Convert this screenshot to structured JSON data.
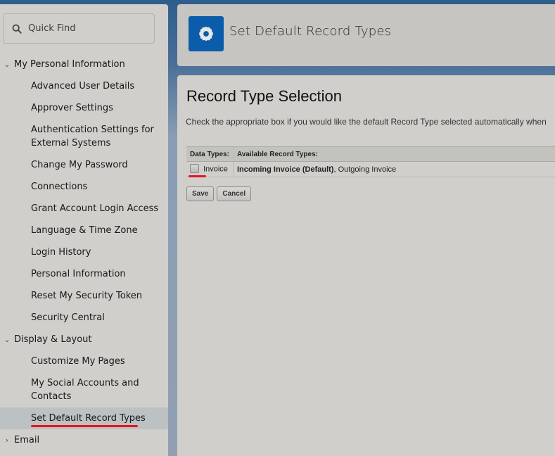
{
  "sidebar": {
    "quick_find_placeholder": "Quick Find",
    "sections": [
      {
        "label": "My Personal Information",
        "expanded": true,
        "items": [
          {
            "label": "Advanced User Details"
          },
          {
            "label": "Approver Settings"
          },
          {
            "label": "Authentication Settings for External Systems"
          },
          {
            "label": "Change My Password"
          },
          {
            "label": "Connections"
          },
          {
            "label": "Grant Account Login Access"
          },
          {
            "label": "Language & Time Zone"
          },
          {
            "label": "Login History"
          },
          {
            "label": "Personal Information"
          },
          {
            "label": "Reset My Security Token"
          },
          {
            "label": "Security Central"
          }
        ]
      },
      {
        "label": "Display & Layout",
        "expanded": true,
        "items": [
          {
            "label": "Customize My Pages"
          },
          {
            "label": "My Social Accounts and Contacts"
          },
          {
            "label": "Set Default Record Types",
            "active": true
          }
        ]
      },
      {
        "label": "Email",
        "expanded": false,
        "items": []
      }
    ]
  },
  "header": {
    "title": "Set Default Record Types",
    "icon": "gear-icon",
    "icon_color": "#0b5cab"
  },
  "main": {
    "title": "Record Type Selection",
    "description": "Check the appropriate box if you would like the default Record Type selected automatically when",
    "table": {
      "headers": [
        "Data Types:",
        "Available Record Types:"
      ],
      "rows": [
        {
          "data_type": "Invoice",
          "checked": false,
          "default_type": "Incoming Invoice (Default)",
          "other_types": ", Outgoing Invoice"
        }
      ]
    },
    "buttons": {
      "save": "Save",
      "cancel": "Cancel"
    }
  },
  "annotations": {
    "highlight_color": "#e8141b"
  }
}
